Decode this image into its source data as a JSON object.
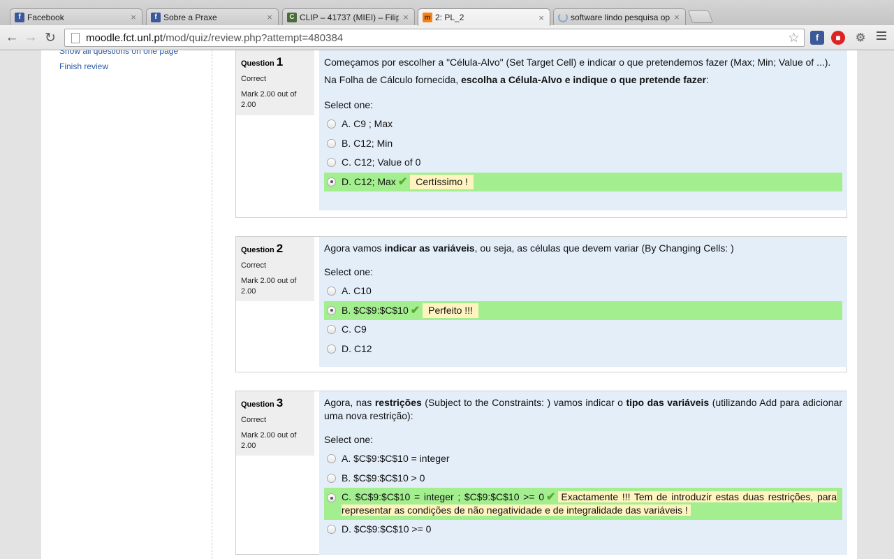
{
  "browser": {
    "tabs": [
      {
        "title": "Facebook",
        "icon": "facebook-icon",
        "active": false
      },
      {
        "title": "Sobre a Praxe",
        "icon": "facebook-icon",
        "active": false
      },
      {
        "title": "CLIP – 41737 (MIEI) – Filip",
        "icon": "clip-icon",
        "active": false
      },
      {
        "title": "2: PL_2",
        "icon": "moodle-icon",
        "active": true
      },
      {
        "title": "software lindo pesquisa op",
        "icon": "loading-icon",
        "active": false
      }
    ],
    "close_glyph": "×",
    "url_host": "moodle.fct.unl.pt",
    "url_path": "/mod/quiz/review.php?attempt=480384"
  },
  "sidebar": {
    "show_all": "Show all questions on one page",
    "finish_review": "Finish review"
  },
  "questions": [
    {
      "label": "Question",
      "number": "1",
      "state": "Correct",
      "grade": "Mark 2.00 out of 2.00",
      "text1": "Começamos por escolher a \"Célula-Alvo\" (Set Target Cell) e indicar o que pretendemos fazer (Max; Min; Value of ...).",
      "text2_pre": "Na Folha de Cálculo fornecida, ",
      "text2_bold": "escolha a Célula-Alvo e indique o que pretende fazer",
      "text2_post": ":",
      "prompt": "Select one:",
      "options": [
        {
          "text": "A. C9 ; Max"
        },
        {
          "text": "B. C12; Min"
        },
        {
          "text": "C. C12; Value of 0"
        },
        {
          "text": "D. C12; Max",
          "feedback": "Certíssimo !"
        }
      ]
    },
    {
      "label": "Question",
      "number": "2",
      "state": "Correct",
      "grade": "Mark 2.00 out of 2.00",
      "text_pre": "Agora vamos ",
      "text_bold": "indicar as variáveis",
      "text_post": ", ou seja, as células que devem variar (By Changing Cells: )",
      "prompt": "Select one:",
      "options": [
        {
          "text": "A. C10"
        },
        {
          "text": "B. $C$9:$C$10",
          "feedback": "Perfeito !!!"
        },
        {
          "text": "C. C9"
        },
        {
          "text": "D. C12"
        }
      ]
    },
    {
      "label": "Question",
      "number": "3",
      "state": "Correct",
      "grade": "Mark 2.00 out of 2.00",
      "text_a": "Agora, nas ",
      "text_b": "restrições",
      "text_c": " (Subject to the Constraints: ) vamos indicar o ",
      "text_d": "tipo das variáveis",
      "text_e": " (utilizando Add para adicionar uma nova restrição):",
      "prompt": "Select one:",
      "options": [
        {
          "text": "A. $C$9:$C$10 = integer"
        },
        {
          "text": "B. $C$9:$C$10 > 0"
        },
        {
          "text": "C. $C$9:$C$10 = integer ; $C$9:$C$10 >= 0",
          "feedback": "Exactamente !!! Tem de introduzir estas duas restrições, para representar as condições de não negatividade e de integralidade das variáveis !"
        },
        {
          "text": "D. $C$9:$C$10 >= 0"
        }
      ]
    }
  ],
  "colors": {
    "correct_bg": "#a3ef8f",
    "feedback_bg": "#fff3bf",
    "formulation_bg": "#e4eef9",
    "link": "#2a59a8"
  }
}
